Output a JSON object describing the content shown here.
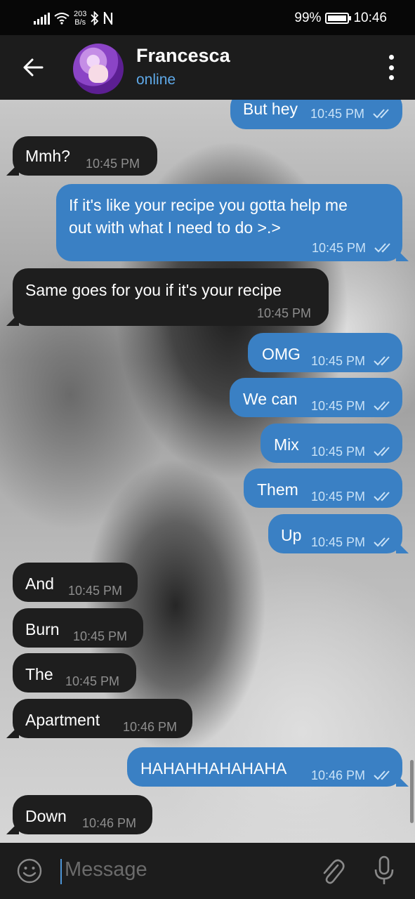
{
  "status_bar": {
    "speed_value": "203",
    "speed_unit": "B/s",
    "battery": "99%",
    "time": "10:46"
  },
  "header": {
    "name": "Francesca",
    "status": "online"
  },
  "messages": [
    {
      "dir": "out",
      "text": "But hey",
      "time": "10:45 PM"
    },
    {
      "dir": "in",
      "text": "Mmh?",
      "time": "10:45 PM"
    },
    {
      "dir": "out",
      "text_line1": "If it's like your recipe you gotta help me",
      "text_line2": "out with what I need to do >.>",
      "time": "10:45 PM"
    },
    {
      "dir": "in",
      "text": "Same goes for you if it's your recipe",
      "time": "10:45 PM"
    },
    {
      "dir": "out",
      "text": "OMG",
      "time": "10:45 PM"
    },
    {
      "dir": "out",
      "text": "We can",
      "time": "10:45 PM"
    },
    {
      "dir": "out",
      "text": "Mix",
      "time": "10:45 PM"
    },
    {
      "dir": "out",
      "text": "Them",
      "time": "10:45 PM"
    },
    {
      "dir": "out",
      "text": "Up",
      "time": "10:45 PM"
    },
    {
      "dir": "in",
      "text": "And",
      "time": "10:45 PM"
    },
    {
      "dir": "in",
      "text": "Burn",
      "time": "10:45 PM"
    },
    {
      "dir": "in",
      "text": "The",
      "time": "10:45 PM"
    },
    {
      "dir": "in",
      "text": "Apartment",
      "time": "10:46 PM"
    },
    {
      "dir": "out",
      "text": "HAHAHHAHAHAHA",
      "time": "10:46 PM"
    },
    {
      "dir": "in",
      "text": "Down",
      "time": "10:46 PM"
    }
  ],
  "input": {
    "placeholder": "Message"
  },
  "icons": {
    "back": "arrow-left-icon",
    "menu": "more-vertical-icon",
    "emoji": "emoji-icon",
    "attach": "paperclip-icon",
    "mic": "microphone-icon",
    "read_status": "double-check-icon"
  },
  "colors": {
    "outgoing_bubble": "#3a80c4",
    "incoming_bubble": "#1e1e1e",
    "online_status": "#5fa9e8"
  }
}
